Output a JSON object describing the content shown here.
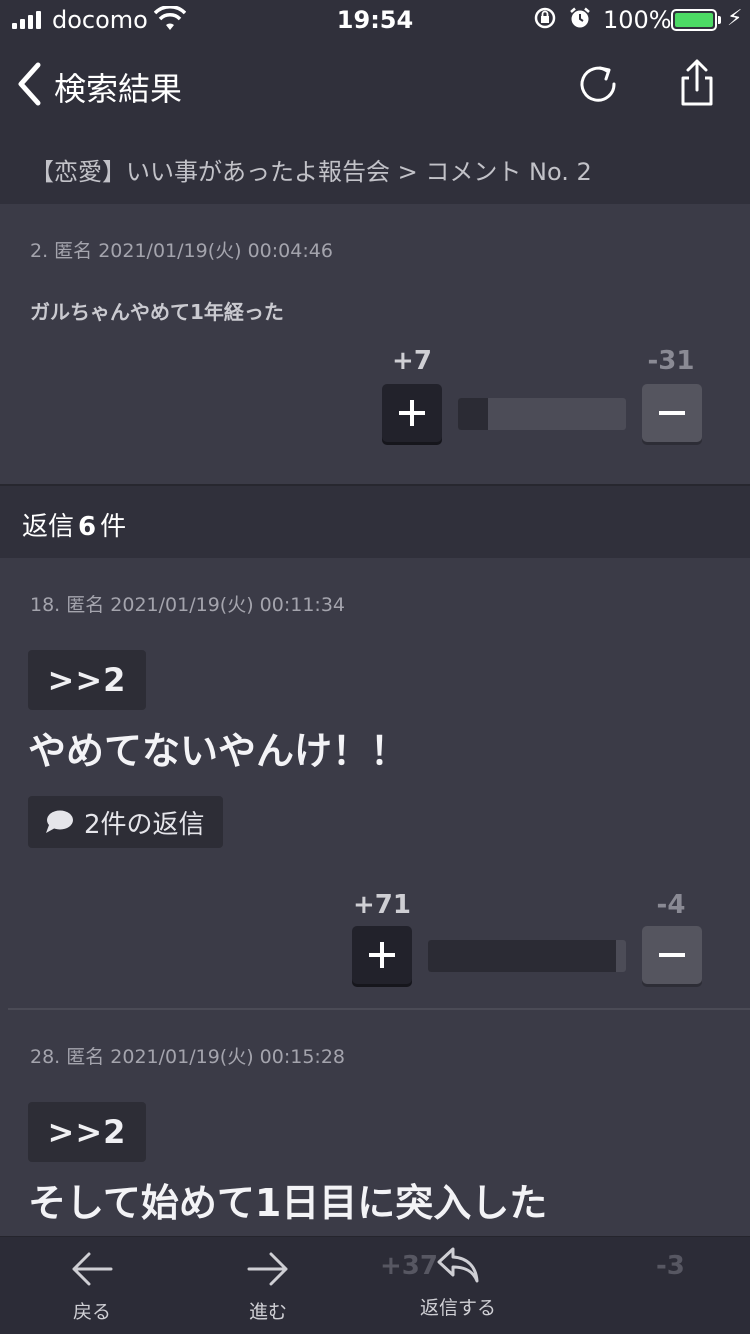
{
  "status": {
    "carrier": "docomo",
    "time": "19:54",
    "battery_pct": "100%",
    "battery_color": "#4cd964"
  },
  "nav": {
    "title": "検索結果",
    "back_icon": "chevron-left-icon",
    "reload_icon": "reload-icon",
    "share_icon": "share-icon"
  },
  "breadcrumb": "【恋愛】いい事があったよ報告会 > コメント No. 2",
  "main_comment": {
    "meta": "2. 匿名 2021/01/19(火) 00:04:46",
    "text": "ガルちゃんやめて1年経った",
    "plus_count": "+7",
    "minus_count": "-31",
    "plus_ratio": 0.18
  },
  "replies_header": {
    "prefix": "返信",
    "count": "6",
    "suffix": "件"
  },
  "replies": [
    {
      "meta": "18. 匿名 2021/01/19(火) 00:11:34",
      "anchor": ">>2",
      "text": "やめてないやんけ！！",
      "reply_count_label": "2件の返信",
      "plus_count": "+71",
      "minus_count": "-4",
      "plus_ratio": 0.95
    },
    {
      "meta": "28. 匿名 2021/01/19(火) 00:15:28",
      "anchor": ">>2",
      "text": "そして始めて1日目に突入した",
      "plus_count": "+37",
      "minus_count": "-3"
    }
  ],
  "bottom_bar": {
    "back_label": "戻る",
    "forward_label": "進む",
    "reply_label": "返信する"
  }
}
